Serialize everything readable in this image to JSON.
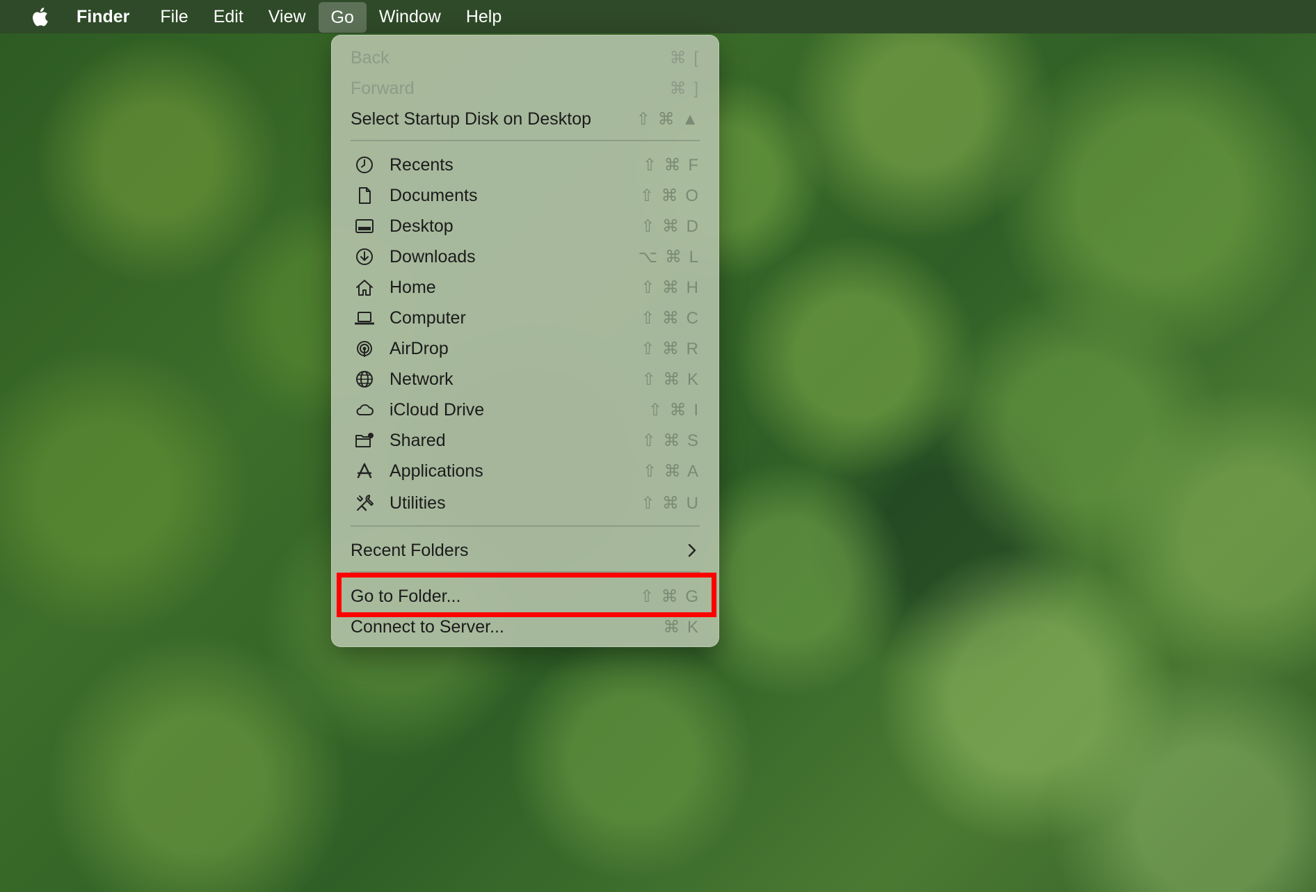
{
  "menubar": {
    "apple_icon": "apple-logo-icon",
    "app_name": "Finder",
    "items": [
      {
        "label": "File"
      },
      {
        "label": "Edit"
      },
      {
        "label": "View"
      },
      {
        "label": "Go",
        "active": true
      },
      {
        "label": "Window"
      },
      {
        "label": "Help"
      }
    ]
  },
  "go_menu": {
    "navigation": [
      {
        "label": "Back",
        "shortcut": "⌘ [",
        "enabled": false
      },
      {
        "label": "Forward",
        "shortcut": "⌘ ]",
        "enabled": false
      },
      {
        "label": "Select Startup Disk on Desktop",
        "shortcut": "⇧ ⌘ ▲",
        "enabled": true
      }
    ],
    "places": [
      {
        "label": "Recents",
        "icon": "clock-icon",
        "shortcut": "⇧ ⌘ F"
      },
      {
        "label": "Documents",
        "icon": "document-icon",
        "shortcut": "⇧ ⌘ O"
      },
      {
        "label": "Desktop",
        "icon": "desktop-icon",
        "shortcut": "⇧ ⌘ D"
      },
      {
        "label": "Downloads",
        "icon": "download-icon",
        "shortcut": "⌥ ⌘ L"
      },
      {
        "label": "Home",
        "icon": "home-icon",
        "shortcut": "⇧ ⌘ H"
      },
      {
        "label": "Computer",
        "icon": "laptop-icon",
        "shortcut": "⇧ ⌘ C"
      },
      {
        "label": "AirDrop",
        "icon": "airdrop-icon",
        "shortcut": "⇧ ⌘ R"
      },
      {
        "label": "Network",
        "icon": "globe-icon",
        "shortcut": "⇧ ⌘ K"
      },
      {
        "label": "iCloud Drive",
        "icon": "cloud-icon",
        "shortcut": "⇧ ⌘ I"
      },
      {
        "label": "Shared",
        "icon": "shared-folder-icon",
        "shortcut": "⇧ ⌘ S"
      },
      {
        "label": "Applications",
        "icon": "applications-icon",
        "shortcut": "⇧ ⌘ A"
      },
      {
        "label": "Utilities",
        "icon": "tools-icon",
        "shortcut": "⇧ ⌘ U"
      }
    ],
    "recent_folders": {
      "label": "Recent Folders",
      "icon": "chevron-right-icon"
    },
    "go_to_folder": {
      "label": "Go to Folder...",
      "shortcut": "⇧ ⌘ G",
      "highlighted": true
    },
    "connect_to_server": {
      "label": "Connect to Server...",
      "shortcut": "⌘ K"
    }
  },
  "colors": {
    "highlight_border": "#ff0000",
    "menubar_bg": "#2f4a28",
    "menu_bg": "#afbea5"
  }
}
